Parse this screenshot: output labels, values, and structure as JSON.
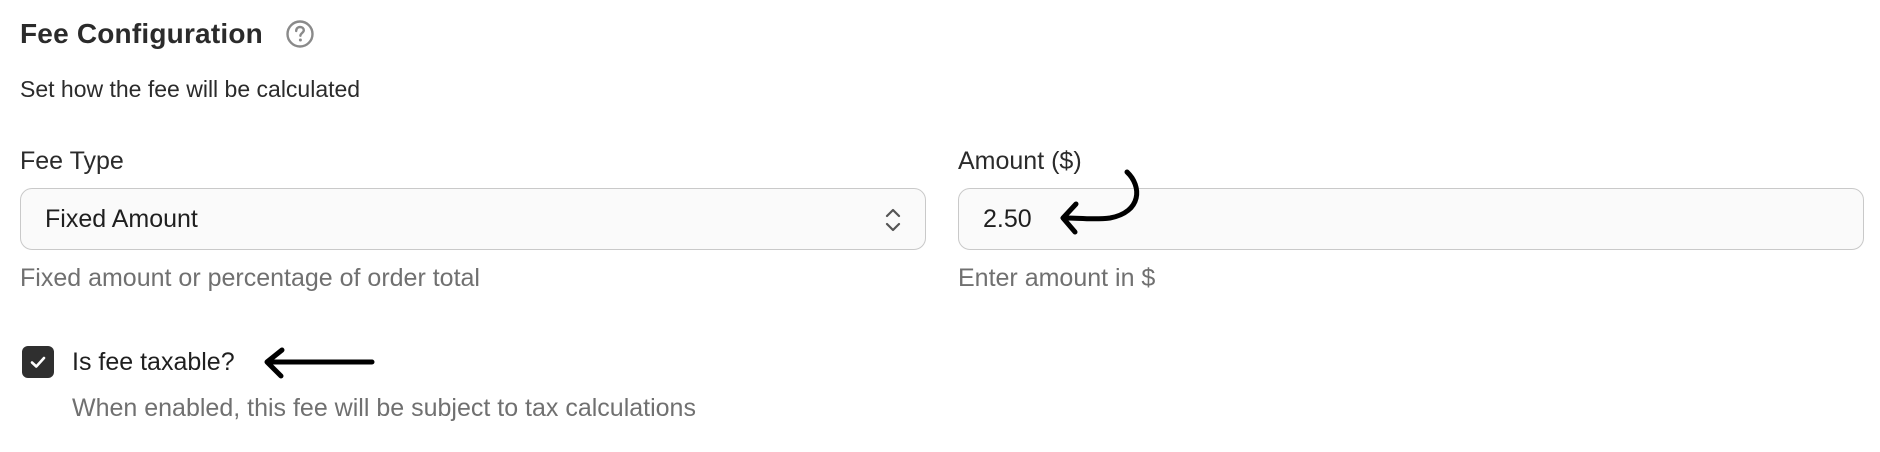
{
  "section": {
    "title": "Fee Configuration",
    "help_icon": "question-circle-icon",
    "subtitle": "Set how the fee will be calculated"
  },
  "fee_type": {
    "label": "Fee Type",
    "selected": "Fixed Amount",
    "helper": "Fixed amount or percentage of order total",
    "icon": "chevron-up-down-icon"
  },
  "amount": {
    "label": "Amount ($)",
    "value": "2.50",
    "helper": "Enter amount in $"
  },
  "taxable": {
    "label": "Is fee taxable?",
    "checked": true,
    "helper": "When enabled, this fee will be subject to tax calculations"
  },
  "colors": {
    "checkbox_fill": "#2f2f2f",
    "helper_text": "#707070",
    "field_border": "#c9c9c9",
    "annotation_arrow": "#000000"
  }
}
